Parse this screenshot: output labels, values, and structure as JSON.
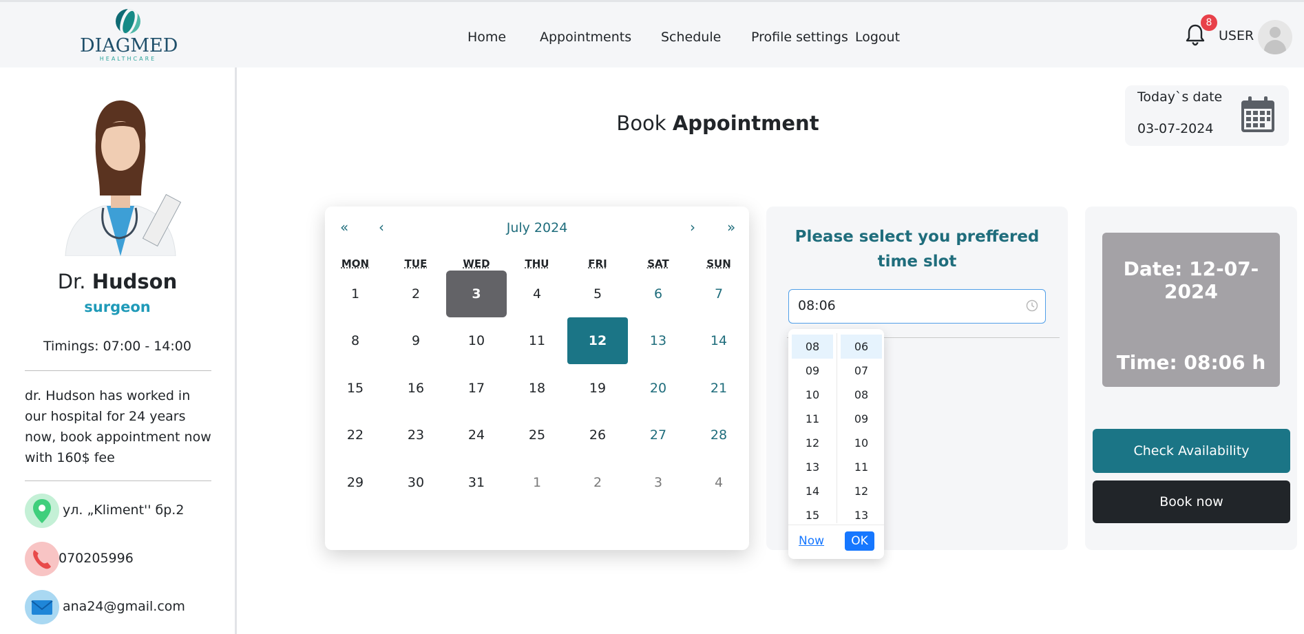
{
  "brand": {
    "name": "DIAGMED",
    "tagline": "HEALTHCARE"
  },
  "nav": {
    "links": [
      "Home",
      "Appointments",
      "Schedule",
      "Profile settings",
      "Logout"
    ],
    "notification_count": "8",
    "user_label": "USER"
  },
  "doctor": {
    "name_prefix": "Dr.",
    "name": "Hudson",
    "specialty": "surgeon",
    "timings": "Timings: 07:00 - 14:00",
    "bio": "dr. Hudson has worked in our hospital for 24 years now, book appointment now with 160$ fee",
    "address": "ул. „Kliment'' бр.2",
    "phone": "070205996",
    "email": "ana24@gmail.com"
  },
  "page": {
    "title_plain": "Book",
    "title_bold": "Appointment",
    "today_label": "Today`s date",
    "today_value": "03-07-2024"
  },
  "calendar": {
    "nav_prev_year": "«",
    "nav_prev_month": "‹",
    "nav_next_month": "›",
    "nav_next_year": "»",
    "month_label": "July 2024",
    "weekdays": [
      "MON",
      "TUE",
      "WED",
      "THU",
      "FRI",
      "SAT",
      "SUN"
    ],
    "weeks": [
      [
        "1",
        "2",
        "3",
        "4",
        "5",
        "6",
        "7"
      ],
      [
        "8",
        "9",
        "10",
        "11",
        "12",
        "13",
        "14"
      ],
      [
        "15",
        "16",
        "17",
        "18",
        "19",
        "20",
        "21"
      ],
      [
        "22",
        "23",
        "24",
        "25",
        "26",
        "27",
        "28"
      ],
      [
        "29",
        "30",
        "31",
        "1",
        "2",
        "3",
        "4"
      ]
    ],
    "today": "3",
    "selected": "12"
  },
  "time_picker": {
    "heading": "Please select you preffered time slot",
    "value": "08:06",
    "hours": [
      "08",
      "09",
      "10",
      "11",
      "12",
      "13",
      "14",
      "15"
    ],
    "minutes": [
      "06",
      "07",
      "08",
      "09",
      "10",
      "11",
      "12",
      "13"
    ],
    "now_label": "Now",
    "ok_label": "OK"
  },
  "summary": {
    "date_text": "Date: 12-07-2024",
    "time_text": "Time: 08:06 h",
    "check_label": "Check Availability",
    "book_label": "Book now"
  },
  "colors": {
    "teal": "#1b7586",
    "specialty": "#1f9ab8",
    "dark": "#212529",
    "today_highlight": "#636367",
    "summary_box": "#a4a2a6",
    "link_blue": "#1677ff"
  },
  "icons": [
    "bell-icon",
    "avatar-icon",
    "calendar-icon",
    "location-pin-icon",
    "phone-icon",
    "mail-icon",
    "clock-icon"
  ]
}
